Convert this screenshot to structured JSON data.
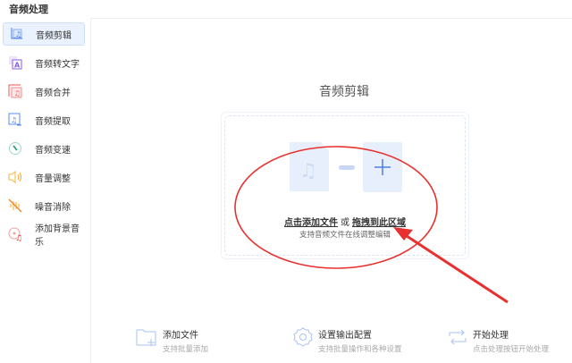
{
  "app_title": "音频处理",
  "sidebar": {
    "items": [
      {
        "label": "音频剪辑",
        "icon": "audio-cut-icon",
        "active": true
      },
      {
        "label": "音频转文字",
        "icon": "audio-to-text-icon"
      },
      {
        "label": "音频合并",
        "icon": "audio-merge-icon"
      },
      {
        "label": "音频提取",
        "icon": "audio-extract-icon"
      },
      {
        "label": "音频变速",
        "icon": "audio-speed-icon"
      },
      {
        "label": "音量调整",
        "icon": "volume-icon"
      },
      {
        "label": "噪音消除",
        "icon": "noise-removal-icon"
      },
      {
        "label": "添加背景音乐",
        "icon": "background-music-icon"
      }
    ]
  },
  "main": {
    "heading": "音频剪辑",
    "drop": {
      "click_add": "点击添加文件",
      "or": "或",
      "drag_here": "拖拽到此区域",
      "hint": "支持音频文件在线调整编辑"
    },
    "actions": [
      {
        "title": "添加文件",
        "subtitle": "支持批量添加",
        "icon": "folder-add-icon"
      },
      {
        "title": "设置输出配置",
        "subtitle": "支持批量操作和各种设置",
        "icon": "gear-icon"
      },
      {
        "title": "开始处理",
        "subtitle": "点击处理按钮开始处理",
        "icon": "repeat-icon"
      }
    ]
  },
  "colors": {
    "accent": "#4a7ee8",
    "annotation": "#e8312f"
  }
}
